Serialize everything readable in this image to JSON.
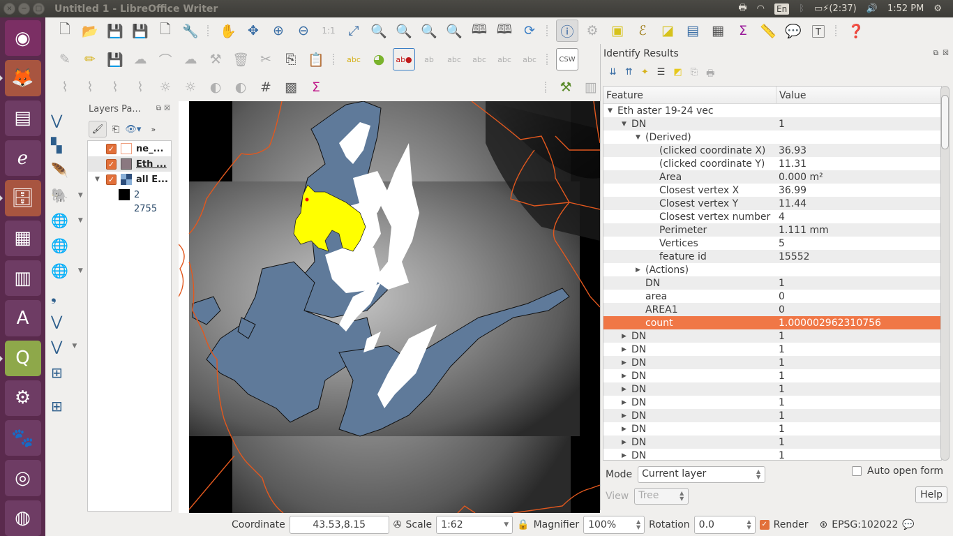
{
  "window": {
    "title": "Untitled 1 - LibreOffice Writer",
    "controls": [
      "close",
      "minimize",
      "maximize"
    ]
  },
  "tray": {
    "language": "En",
    "battery": "(2:37)",
    "clock": "1:52 PM"
  },
  "launcher": {
    "items": [
      {
        "name": "ubuntu-dash",
        "glyph": "◉",
        "color": "#7b2f64"
      },
      {
        "name": "firefox",
        "glyph": "🦊",
        "color": "#a85540",
        "active": true
      },
      {
        "name": "libreoffice-writer",
        "glyph": "▤",
        "color": "#6e3c64"
      },
      {
        "name": "document-viewer",
        "glyph": "ℯ",
        "color": "#6e3c64"
      },
      {
        "name": "files",
        "glyph": "🗄",
        "color": "#a85540",
        "active": true
      },
      {
        "name": "calculator",
        "glyph": "▦",
        "color": "#6e3c64"
      },
      {
        "name": "libreoffice-calc",
        "glyph": "▥",
        "color": "#6e3c64"
      },
      {
        "name": "software-center",
        "glyph": "A",
        "color": "#6e3c64"
      },
      {
        "name": "qgis",
        "glyph": "Q",
        "color": "#8ea84a",
        "active": true
      },
      {
        "name": "system-settings",
        "glyph": "⚙",
        "color": "#6e3c64"
      },
      {
        "name": "gimp",
        "glyph": "🐾",
        "color": "#6e3c64"
      },
      {
        "name": "rhythmbox",
        "glyph": "◎",
        "color": "#6e3c64"
      },
      {
        "name": "google-earth",
        "glyph": "◍",
        "color": "#6e3c64"
      }
    ]
  },
  "toolbar": {
    "csw_label": "CSW",
    "row1": [
      "new-project",
      "open-project",
      "save-project",
      "save-as",
      "new-print-composer",
      "composer-manager",
      "pan",
      "pan-to-selection",
      "zoom-in",
      "zoom-out",
      "zoom-native",
      "zoom-full",
      "zoom-to-selection",
      "zoom-to-layer",
      "zoom-last",
      "zoom-next",
      "new-bookmark",
      "show-bookmarks",
      "refresh",
      "identify",
      "run-action",
      "select-features",
      "select-by-expression",
      "deselect",
      "attribute-table",
      "field-calculator",
      "statistics",
      "measure",
      "map-tips",
      "text-annotation",
      "help"
    ],
    "row2": [
      "current-edits",
      "toggle-editing",
      "save-edits",
      "add-feature",
      "vertex-tool",
      "move-feature",
      "node-tool",
      "delete-selected",
      "cut-features",
      "copy-features",
      "paste-features",
      "layer-labeling",
      "diagram",
      "pin-labels",
      "show-hide-labels",
      "preview-labels",
      "move-label",
      "rotate-label",
      "change-label",
      "csw"
    ],
    "row3": [
      "local-histogram-stretch",
      "full-histogram-stretch",
      "local-cumulative",
      "full-cumulative",
      "increase-brightness",
      "decrease-brightness",
      "increase-contrast",
      "decrease-contrast",
      "georeferencer-grid",
      "heatmap",
      "zonal-statistics",
      "geoprocessing",
      "print-layout"
    ]
  },
  "layers_panel": {
    "title": "Layers Pa...",
    "layers": [
      {
        "name": "ne_...",
        "checked": true,
        "swatch": "#ffffff",
        "swatch_border": "#f0a080",
        "selected": false
      },
      {
        "name": "Eth ...",
        "checked": true,
        "swatch": "#8a7880",
        "selected": true,
        "underline": true
      },
      {
        "name": "all E...",
        "checked": true,
        "swatch": "raster",
        "expanded": true
      }
    ],
    "raster_legend": {
      "min_label": "2",
      "max_label": "2755"
    }
  },
  "identify": {
    "title": "Identify Results",
    "columns": [
      "Feature",
      "Value"
    ],
    "rows": [
      {
        "indent": 0,
        "arrow": "down",
        "feature": "Eth aster 19-24 vec",
        "value": ""
      },
      {
        "indent": 1,
        "arrow": "down",
        "feature": "DN",
        "value": "1"
      },
      {
        "indent": 2,
        "arrow": "down",
        "feature": "(Derived)",
        "value": ""
      },
      {
        "indent": 3,
        "arrow": "",
        "feature": "(clicked coordinate X)",
        "value": "36.93"
      },
      {
        "indent": 3,
        "arrow": "",
        "feature": "(clicked coordinate Y)",
        "value": "11.31"
      },
      {
        "indent": 3,
        "arrow": "",
        "feature": "Area",
        "value": "0.000 m²"
      },
      {
        "indent": 3,
        "arrow": "",
        "feature": "Closest vertex X",
        "value": "36.99"
      },
      {
        "indent": 3,
        "arrow": "",
        "feature": "Closest vertex Y",
        "value": "11.44"
      },
      {
        "indent": 3,
        "arrow": "",
        "feature": "Closest vertex number",
        "value": "4"
      },
      {
        "indent": 3,
        "arrow": "",
        "feature": "Perimeter",
        "value": "1.111 mm"
      },
      {
        "indent": 3,
        "arrow": "",
        "feature": "Vertices",
        "value": "5"
      },
      {
        "indent": 3,
        "arrow": "",
        "feature": "feature id",
        "value": "15552"
      },
      {
        "indent": 2,
        "arrow": "right",
        "feature": "(Actions)",
        "value": ""
      },
      {
        "indent": 2,
        "arrow": "",
        "feature": "DN",
        "value": "1"
      },
      {
        "indent": 2,
        "arrow": "",
        "feature": "area",
        "value": "0"
      },
      {
        "indent": 2,
        "arrow": "",
        "feature": "AREA1",
        "value": "0"
      },
      {
        "indent": 2,
        "arrow": "",
        "feature": "count",
        "value": "1.000002962310756",
        "highlighted": true
      },
      {
        "indent": 1,
        "arrow": "right",
        "feature": "DN",
        "value": "1"
      },
      {
        "indent": 1,
        "arrow": "right",
        "feature": "DN",
        "value": "1"
      },
      {
        "indent": 1,
        "arrow": "right",
        "feature": "DN",
        "value": "1"
      },
      {
        "indent": 1,
        "arrow": "right",
        "feature": "DN",
        "value": "1"
      },
      {
        "indent": 1,
        "arrow": "right",
        "feature": "DN",
        "value": "1"
      },
      {
        "indent": 1,
        "arrow": "right",
        "feature": "DN",
        "value": "1"
      },
      {
        "indent": 1,
        "arrow": "right",
        "feature": "DN",
        "value": "1"
      },
      {
        "indent": 1,
        "arrow": "right",
        "feature": "DN",
        "value": "1"
      },
      {
        "indent": 1,
        "arrow": "right",
        "feature": "DN",
        "value": "1"
      },
      {
        "indent": 1,
        "arrow": "right",
        "feature": "DN",
        "value": "1"
      }
    ],
    "mode_label": "Mode",
    "mode_value": "Current layer",
    "view_label": "View",
    "view_value": "Tree",
    "auto_open_form_label": "Auto open form",
    "auto_open_form_checked": false,
    "help_label": "Help",
    "highlight_color": "#f07746"
  },
  "statusbar": {
    "coordinate_label": "Coordinate",
    "coordinate_value": "43.53,8.15",
    "scale_label": "Scale",
    "scale_value": "1:62",
    "magnifier_label": "Magnifier",
    "magnifier_value": "100%",
    "rotation_label": "Rotation",
    "rotation_value": "0.0",
    "render_label": "Render",
    "render_checked": true,
    "crs_label": "EPSG:102022"
  },
  "map": {
    "highlight_color": "#ffff00",
    "vector_fill": "#5f7a9a",
    "boundary_color": "#e2581e"
  }
}
